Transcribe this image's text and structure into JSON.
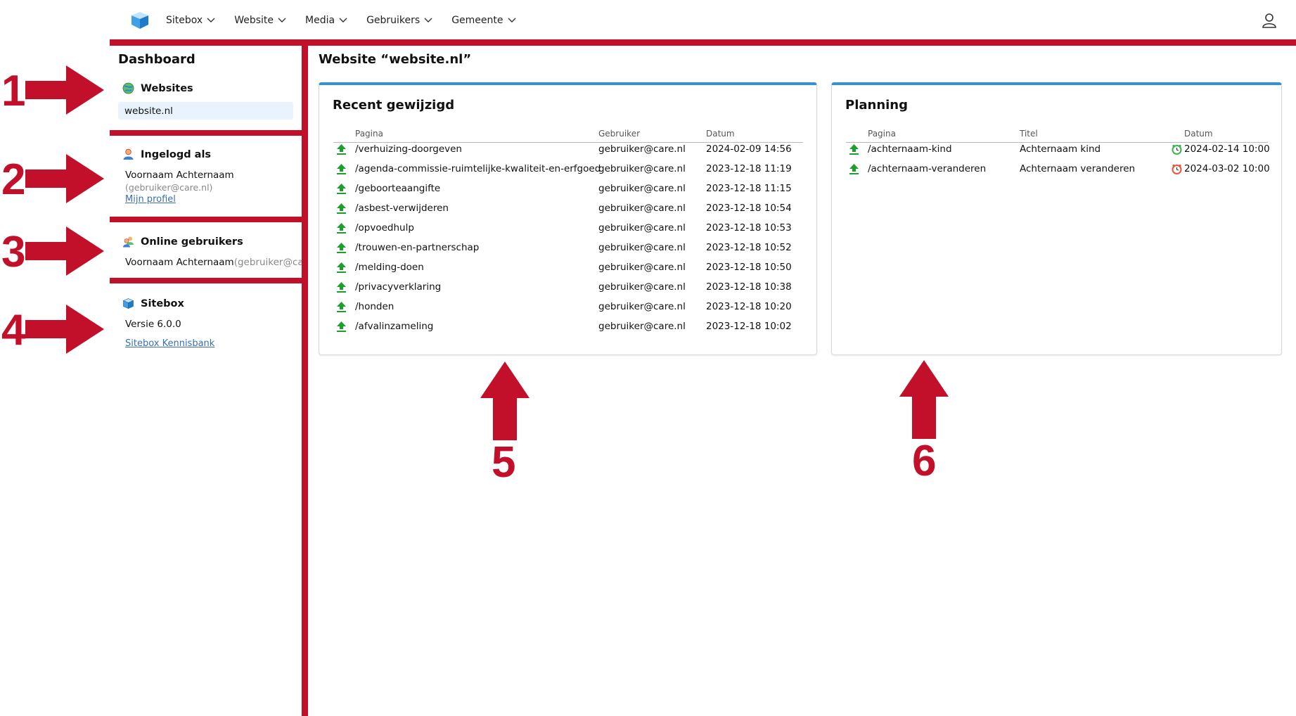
{
  "nav": {
    "items": [
      {
        "label": "Sitebox"
      },
      {
        "label": "Website"
      },
      {
        "label": "Media"
      },
      {
        "label": "Gebruikers"
      },
      {
        "label": "Gemeente"
      }
    ]
  },
  "sidebar": {
    "title": "Dashboard",
    "websites": {
      "heading": "Websites",
      "items": [
        "website.nl"
      ]
    },
    "logged_in": {
      "heading": "Ingelogd als",
      "name": "Voornaam Achternaam",
      "email": "(gebruiker@care.nl)",
      "profile_link": "Mijn profiel"
    },
    "online": {
      "heading": "Online gebruikers",
      "name": "Voornaam Achternaam",
      "email": "(gebruiker@care"
    },
    "sitebox": {
      "heading": "Sitebox",
      "version": "Versie 6.0.0",
      "kb_link": "Sitebox Kennisbank"
    }
  },
  "main": {
    "title": "Website “website.nl”",
    "recent": {
      "title": "Recent gewijzigd",
      "columns": [
        "Pagina",
        "Gebruiker",
        "Datum"
      ],
      "rows": [
        {
          "page": "/verhuizing-doorgeven",
          "user": "gebruiker@care.nl",
          "date": "2024-02-09 14:56"
        },
        {
          "page": "/agenda-commissie-ruimtelijke-kwaliteit-en-erfgoed",
          "user": "gebruiker@care.nl",
          "date": "2023-12-18 11:19"
        },
        {
          "page": "/geboorteaangifte",
          "user": "gebruiker@care.nl",
          "date": "2023-12-18 11:15"
        },
        {
          "page": "/asbest-verwijderen",
          "user": "gebruiker@care.nl",
          "date": "2023-12-18 10:54"
        },
        {
          "page": "/opvoedhulp",
          "user": "gebruiker@care.nl",
          "date": "2023-12-18 10:53"
        },
        {
          "page": "/trouwen-en-partnerschap",
          "user": "gebruiker@care.nl",
          "date": "2023-12-18 10:52"
        },
        {
          "page": "/melding-doen",
          "user": "gebruiker@care.nl",
          "date": "2023-12-18 10:50"
        },
        {
          "page": "/privacyverklaring",
          "user": "gebruiker@care.nl",
          "date": "2023-12-18 10:38"
        },
        {
          "page": "/honden",
          "user": "gebruiker@care.nl",
          "date": "2023-12-18 10:20"
        },
        {
          "page": "/afvalinzameling",
          "user": "gebruiker@care.nl",
          "date": "2023-12-18 10:02"
        }
      ]
    },
    "planning": {
      "title": "Planning",
      "columns": [
        "Pagina",
        "Titel",
        "Datum"
      ],
      "rows": [
        {
          "page": "/achternaam-kind",
          "title": "Achternaam kind",
          "date": "2024-02-14 10:00",
          "clock_color": "#3bb54a"
        },
        {
          "page": "/achternaam-veranderen",
          "title": "Achternaam veranderen",
          "date": "2024-03-02 10:00",
          "clock_color": "#e8533a"
        }
      ]
    }
  },
  "annotations": [
    "1",
    "2",
    "3",
    "4",
    "5",
    "6"
  ],
  "colors": {
    "accent_red": "#c20f2a",
    "panel_blue": "#3490dc",
    "upload_green": "#1e9e2e",
    "link_blue": "#3a6fb0"
  }
}
